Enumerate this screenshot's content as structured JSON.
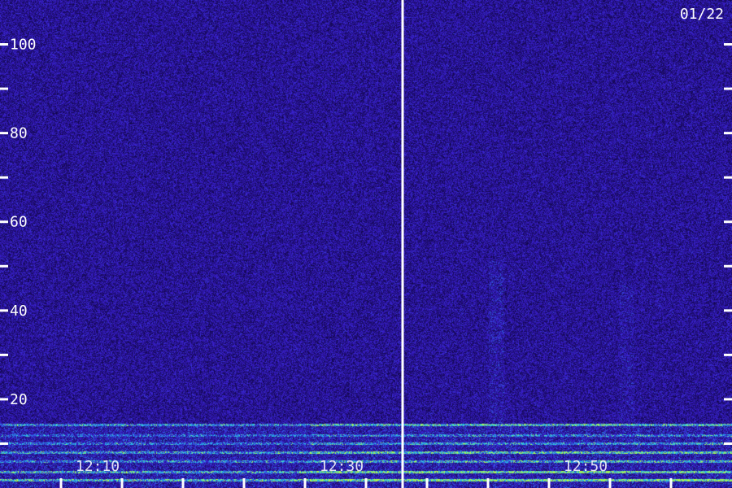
{
  "chart_data": {
    "type": "heatmap",
    "title": "",
    "date_label": "01/22",
    "xlabel": "",
    "ylabel": "",
    "y_ticks": [
      "100",
      "80",
      "60",
      "40",
      "20"
    ],
    "y_minor_ticks": [
      10,
      30,
      50,
      70,
      90
    ],
    "ylim": [
      0,
      110
    ],
    "x_ticks": [
      "12:10",
      "12:30",
      "12:50"
    ],
    "x_range": [
      "12:02",
      "13:02"
    ],
    "time_marker": "12:35",
    "colors": {
      "background": "#2a0a6e",
      "low": "#12064a",
      "mid": "#3a1fd0",
      "high": "#20c8f0",
      "peak": "#b8ff40",
      "marker": "#ffffff"
    }
  }
}
